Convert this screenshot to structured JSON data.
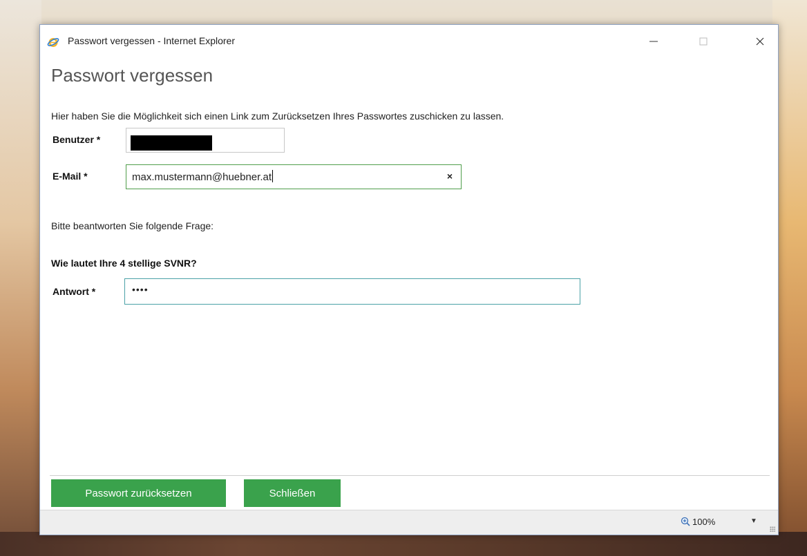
{
  "window": {
    "title": "Passwort vergessen - Internet Explorer",
    "minimize_glyph": "—",
    "maximize_glyph": "☐",
    "close_glyph": "✕"
  },
  "page": {
    "heading": "Passwort vergessen",
    "intro": "Hier haben Sie die Möglichkeit sich einen Link zum Zurücksetzen Ihres Passwortes zuschicken zu lassen."
  },
  "form": {
    "user_label": "Benutzer *",
    "email_label": "E-Mail *",
    "email_value": "max.mustermann@huebner.at",
    "email_clear": "×",
    "hint": "Bitte beantworten Sie folgende Frage:",
    "question": "Wie lautet Ihre 4 stellige SVNR?",
    "answer_label": "Antwort *",
    "answer_value": "••••"
  },
  "buttons": {
    "reset": "Passwort zurücksetzen",
    "close": "Schließen"
  },
  "statusbar": {
    "zoom": "100%",
    "zoom_dropdown": "▼"
  },
  "icons": {
    "browser": "internet-explorer-icon",
    "zoom": "zoom-icon"
  },
  "colors": {
    "button_green": "#3aa24c",
    "email_border": "#4f9d4a",
    "answer_border": "#4aa1a7"
  }
}
